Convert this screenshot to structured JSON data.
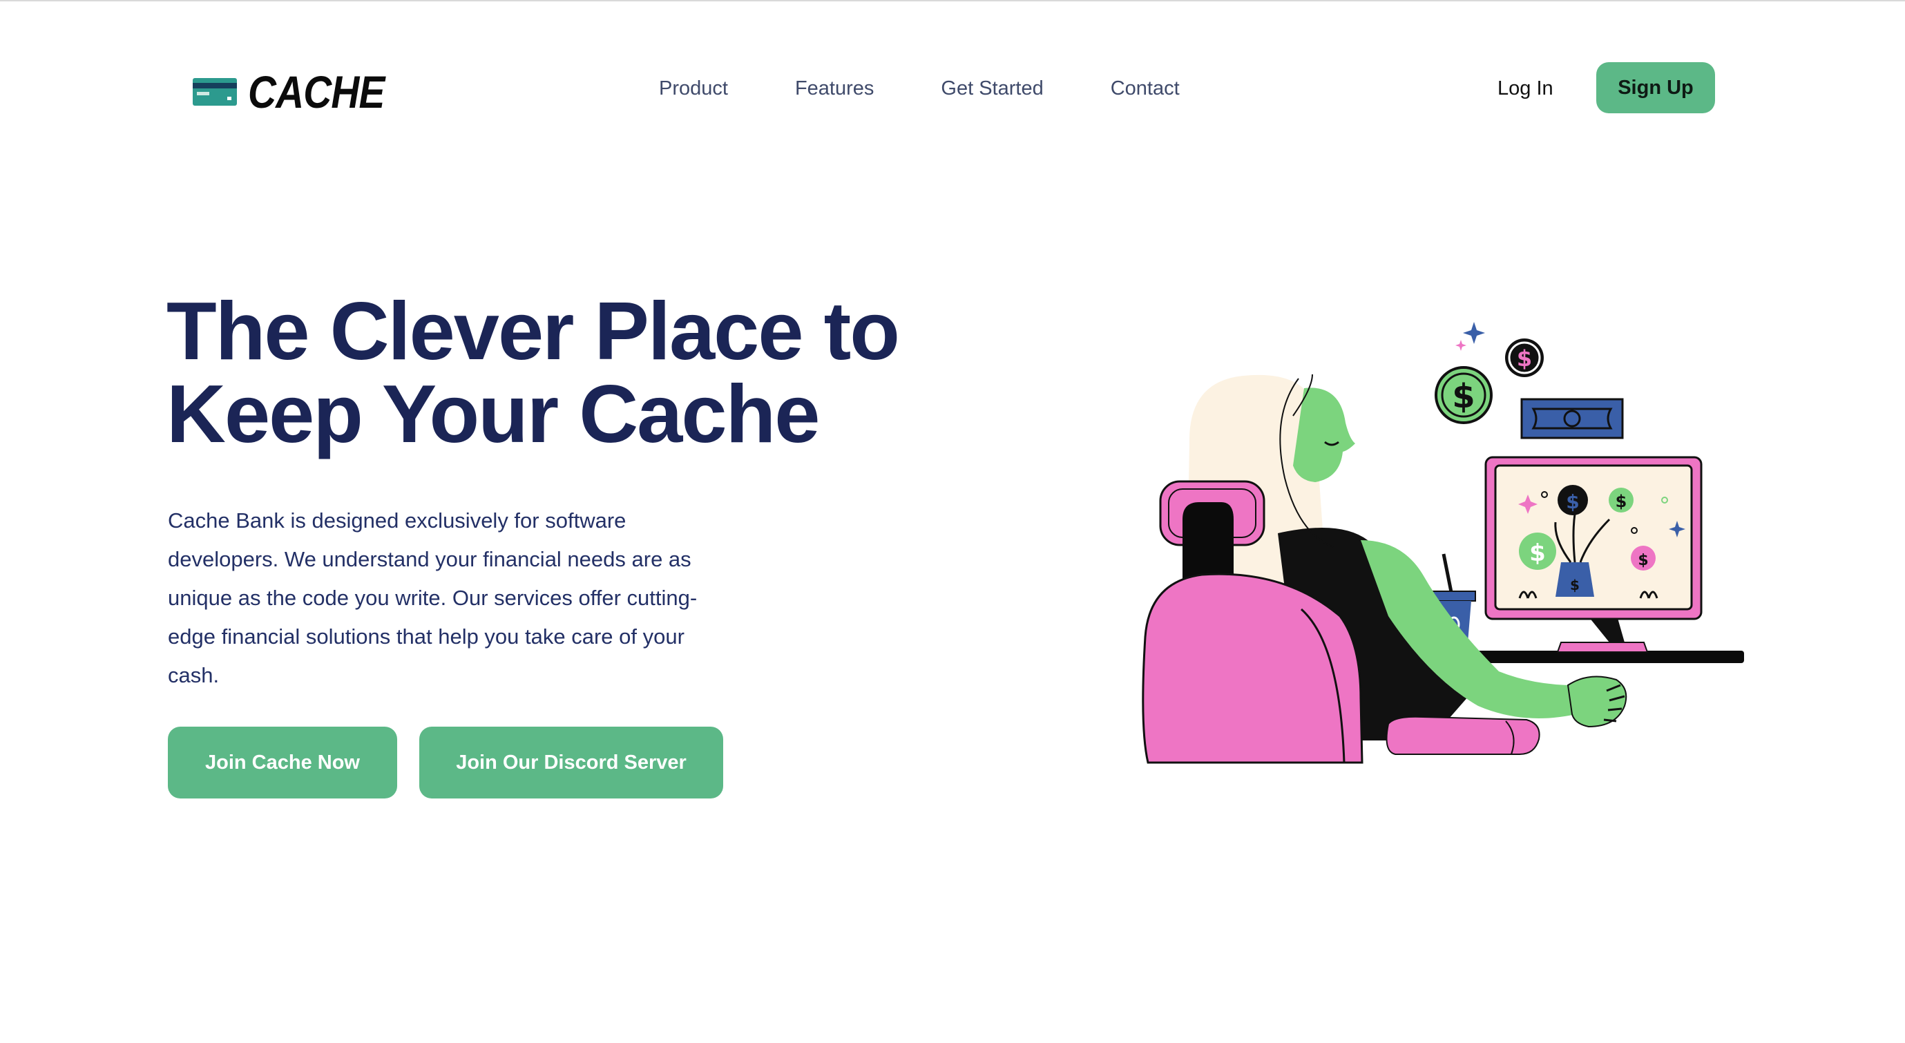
{
  "brand": {
    "name": "CACHE",
    "logo_icon": "credit-card-icon"
  },
  "nav": {
    "links": [
      "Product",
      "Features",
      "Get Started",
      "Contact"
    ],
    "login_label": "Log In",
    "signup_label": "Sign Up"
  },
  "hero": {
    "title_line1": "The Clever Place to",
    "title_line2": "Keep Your Cache",
    "description": "Cache Bank is designed exclusively for software developers. We understand your financial needs are as unique as the code you write. Our services offer cutting-edge financial solutions that help you take care of your cash.",
    "primary_cta": "Join Cache Now",
    "secondary_cta": "Join Our Discord Server"
  },
  "colors": {
    "accent_green": "#5cb887",
    "navy": "#1b2556",
    "pink": "#ee75c4",
    "skin_green": "#7cd47e",
    "blue": "#3a5fa8",
    "cream": "#fcf2e2"
  }
}
